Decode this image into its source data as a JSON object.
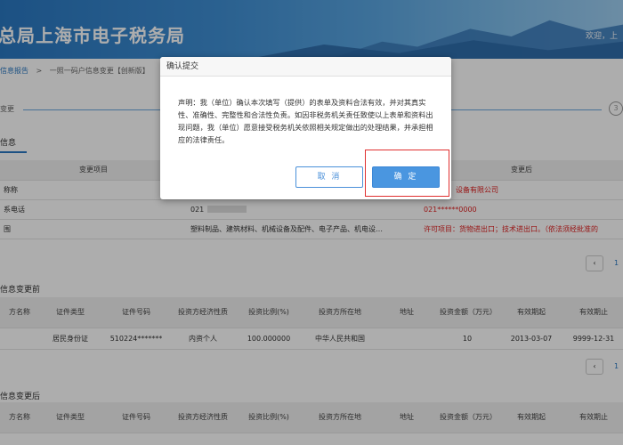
{
  "header": {
    "title": "总局上海市电子税务局",
    "welcome": "欢迎，上"
  },
  "breadcrumb": {
    "items": [
      "信息报告",
      "一照一码户信息变更【创新版】"
    ],
    "separator": ">"
  },
  "steps": {
    "label": "变更",
    "step3": "3"
  },
  "section1": {
    "title": "信息",
    "headers": [
      "变更项目",
      "",
      "变更后"
    ],
    "rows": [
      {
        "item": "称称",
        "before": "",
        "after": "设备有限公司"
      },
      {
        "item": "系电话",
        "before": "021",
        "after": "021******0000"
      },
      {
        "item": "围",
        "before": "塑料制品、建筑材料、机械设备及配件、电子产品、机电设…",
        "after": "许可项目：货物进出口；技术进出口。（依法须经批准的"
      }
    ]
  },
  "section2": {
    "title": "信息变更前",
    "headers": [
      "方名称",
      "证件类型",
      "证件号码",
      "投资方经济性质",
      "投资比例(%)",
      "投资方所在地",
      "地址",
      "投资金额（万元）",
      "有效期起",
      "有效期止"
    ],
    "rows": [
      [
        "",
        "居民身份证",
        "510224*******",
        "内资个人",
        "100.000000",
        "中华人民共和国",
        "",
        "10",
        "2013-03-07",
        "9999-12-31"
      ]
    ]
  },
  "section3": {
    "title": "信息变更后",
    "headers": [
      "方名称",
      "证件类型",
      "证件号码",
      "投资方经济性质",
      "投资比例(%)",
      "投资方所在地",
      "地址",
      "投资金额（万元）",
      "有效期起",
      "有效期止"
    ]
  },
  "pagination": {
    "prev": "‹",
    "page": "1"
  },
  "modal": {
    "title": "确认提交",
    "body": "声明：我（单位）确认本次填写（提供）的表单及资料合法有效，并对其真实性、准确性、完整性和合法性负责。如因非税务机关责任致使以上表单和资料出现问题，我（单位）愿意接受税务机关依照相关规定做出的处理结果，并承担相应的法律责任。",
    "cancel_label": "取 消",
    "ok_label": "确 定"
  },
  "colors": {
    "accent": "#4a96e0",
    "highlight": "#e03030",
    "changed_text": "#e02020"
  }
}
